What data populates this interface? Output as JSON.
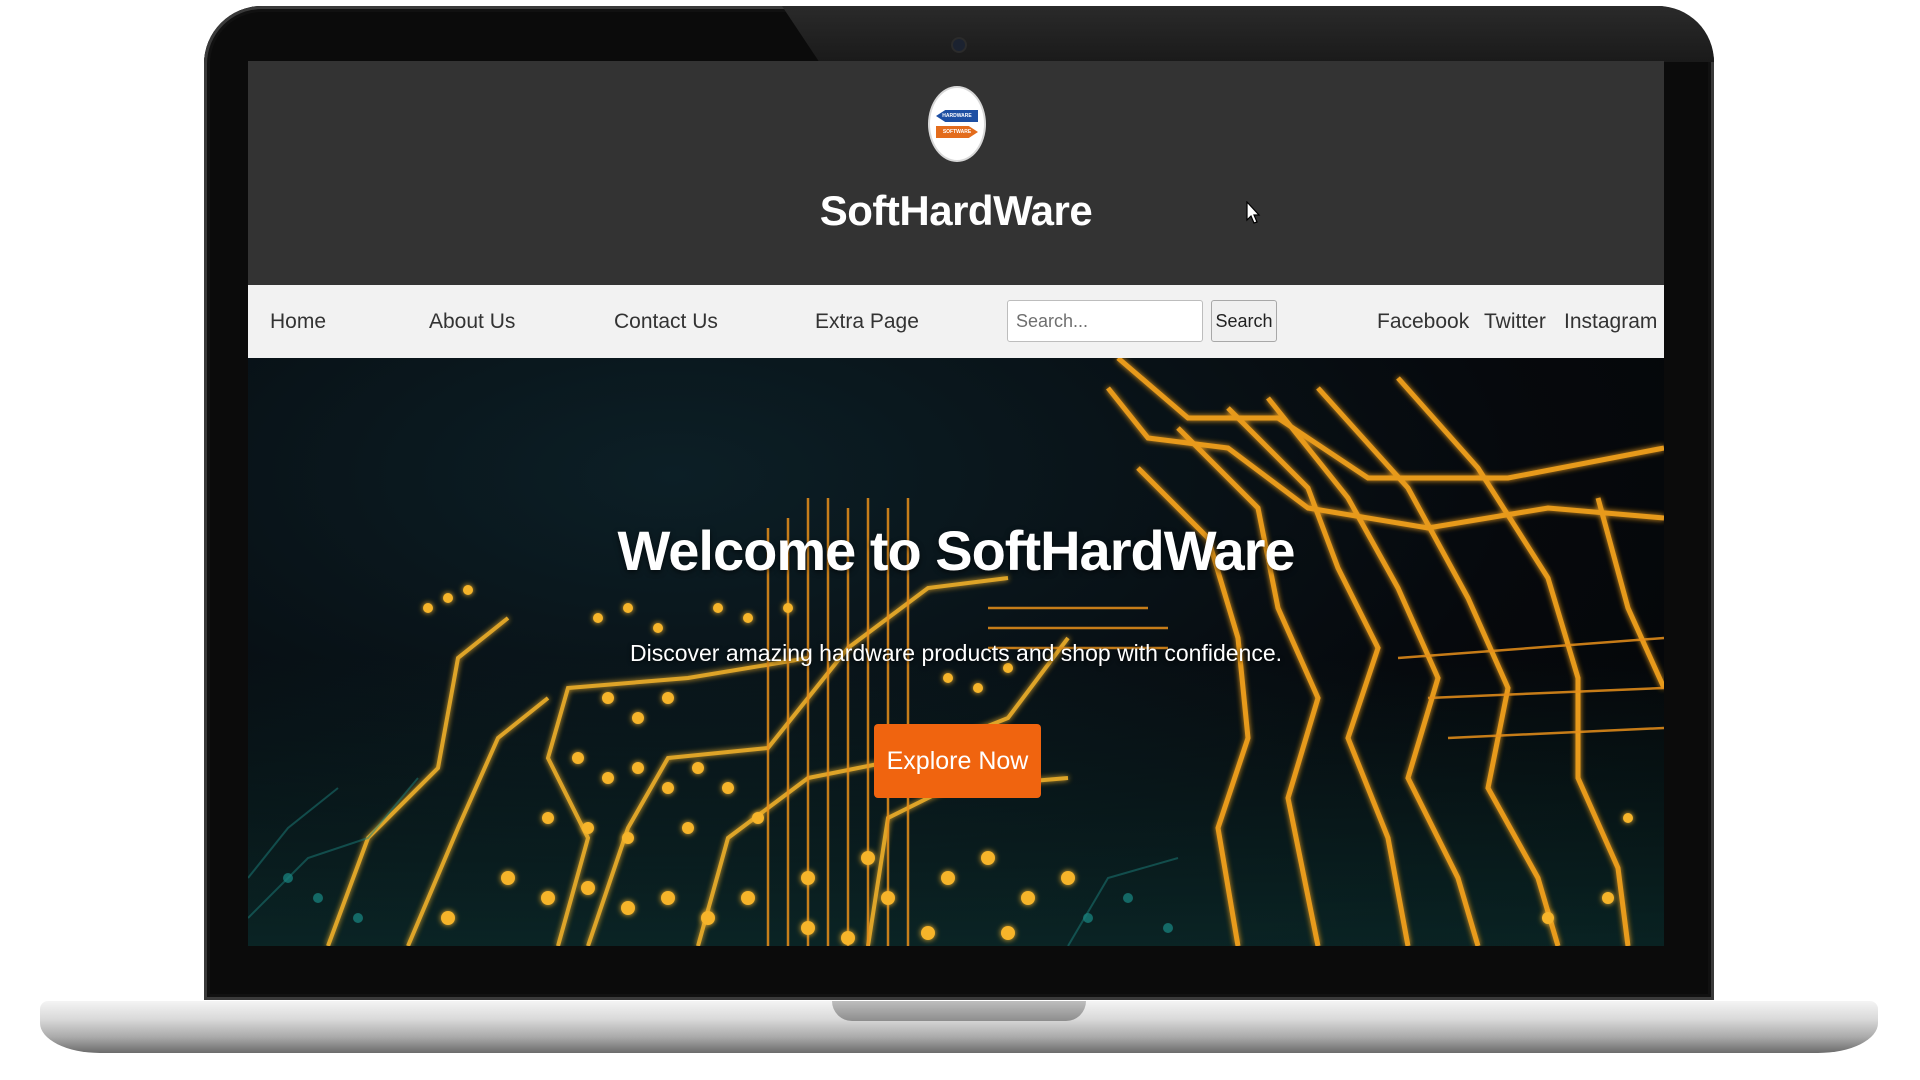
{
  "site": {
    "logo": {
      "top_text": "HARDWARE",
      "bottom_text": "SOFTWARE",
      "colors": {
        "top": "#1d4fa3",
        "bottom": "#e36c1c"
      }
    },
    "title": "SoftHardWare"
  },
  "nav": {
    "links": [
      {
        "label": "Home"
      },
      {
        "label": "About Us"
      },
      {
        "label": "Contact Us"
      },
      {
        "label": "Extra Page"
      }
    ],
    "search": {
      "placeholder": "Search...",
      "value": "",
      "button_label": "Search"
    },
    "social": [
      {
        "label": "Facebook"
      },
      {
        "label": "Twitter"
      },
      {
        "label": "Instagram"
      }
    ]
  },
  "hero": {
    "title": "Welcome to SoftHardWare",
    "subtitle": "Discover amazing hardware products and shop with confidence.",
    "cta_label": "Explore Now",
    "background": "circuit-board-image"
  },
  "colors": {
    "header_bg": "#333333",
    "nav_bg": "#f2f2f2",
    "accent": "#f0640f",
    "circuit_gold": "#f4a21e"
  }
}
